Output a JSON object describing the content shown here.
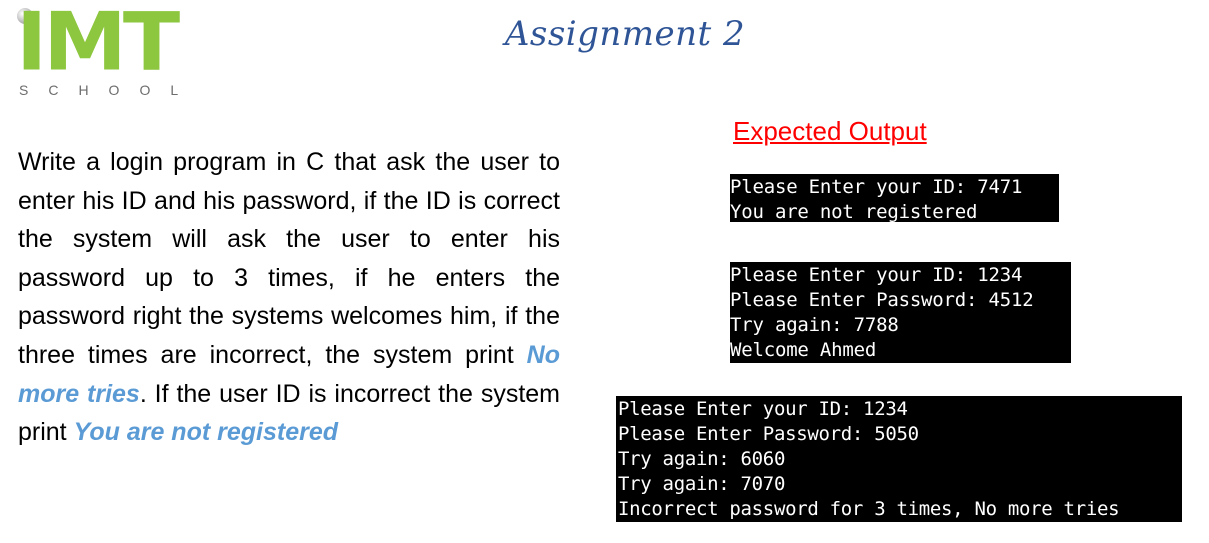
{
  "logo": {
    "main_text": "IMT",
    "sub_text": "SCHOOL",
    "brand_color": "#8dc63f"
  },
  "title": "Assignment 2",
  "description": {
    "part1": "Write a login program in C that ask the user to enter his ID and his password, if the ID is correct the system will ask the user to enter his password up to 3 times, if he enters the password right the systems welcomes him, if the three times are incorrect, the system print ",
    "highlight1": "No more tries",
    "part2": ". If the user ID is incorrect the system print ",
    "highlight2": "You are not registered"
  },
  "expected_output_label": "Expected Output",
  "consoles": [
    {
      "lines": [
        "Please Enter your ID: 7471",
        "You are not registered"
      ]
    },
    {
      "lines": [
        "Please Enter your ID: 1234",
        "Please Enter Password: 4512",
        "Try again: 7788",
        "Welcome Ahmed"
      ]
    },
    {
      "lines": [
        "Please Enter your ID: 1234",
        "Please Enter Password: 5050",
        "Try again: 6060",
        "Try again: 7070",
        "Incorrect password for 3 times, No more tries"
      ]
    }
  ],
  "colors": {
    "title": "#2f5597",
    "highlight": "#5b9bd5",
    "expected_label": "#ff0000",
    "console_bg": "#000000",
    "console_text": "#ffffff"
  }
}
